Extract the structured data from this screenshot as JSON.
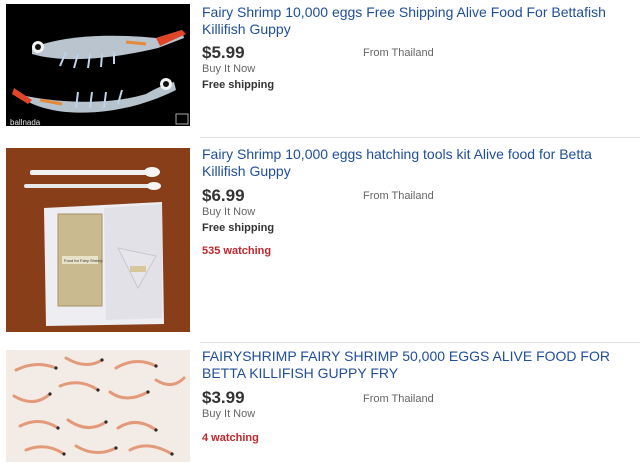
{
  "listings": [
    {
      "title": "Fairy Shrimp 10,000 eggs Free Shipping Alive Food For Bettafish Killifish Guppy",
      "price": "$5.99",
      "format": "Buy It Now",
      "shipping": "Free shipping",
      "origin": "From Thailand",
      "image_caption": "ballnada"
    },
    {
      "title": "Fairy Shrimp 10,000 eggs hatching tools kit Alive food for Betta Killifish Guppy",
      "price": "$6.99",
      "format": "Buy It Now",
      "shipping": "Free shipping",
      "watching": "535 watching",
      "origin": "From Thailand",
      "package_label": "Food for Fairy Shrimp"
    },
    {
      "title": "FAIRYSHRIMP FAIRY SHRIMP 50,000 EGGS ALIVE FOOD FOR BETTA KILLIFISH GUPPY FRY",
      "price": "$3.99",
      "format": "Buy It Now",
      "watching": "4 watching",
      "origin": "From Thailand"
    }
  ],
  "colors": {
    "title_link": "#1f4e9b",
    "watching": "#c0272d",
    "price": "#333333"
  }
}
